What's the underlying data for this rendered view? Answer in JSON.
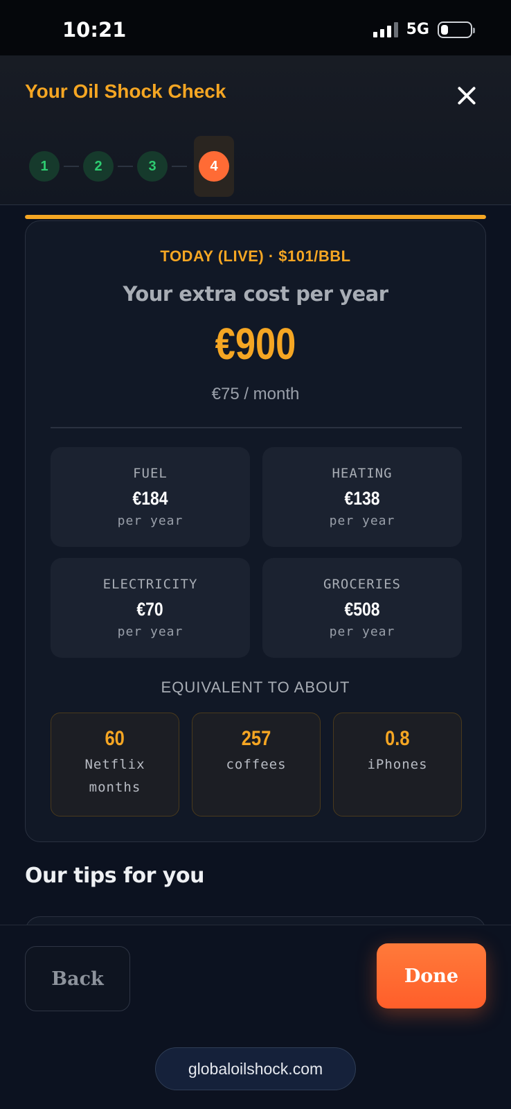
{
  "status_bar": {
    "time": "10:21",
    "network": "5G",
    "battery_level": 0.25
  },
  "header": {
    "title": "Your Oil Shock Check",
    "close_icon": "close-icon",
    "steps": [
      {
        "label": "1",
        "state": "done"
      },
      {
        "label": "2",
        "state": "done"
      },
      {
        "label": "3",
        "state": "done"
      },
      {
        "label": "4",
        "state": "active"
      }
    ]
  },
  "progress": {
    "fraction": 1.0
  },
  "result": {
    "live_label": "TODAY (LIVE) · $101/BBL",
    "heading": "Your extra cost per year",
    "amount": "€900",
    "monthly": "€75 / month",
    "breakdown": [
      {
        "name": "FUEL",
        "value": "€184",
        "unit": "per year"
      },
      {
        "name": "HEATING",
        "value": "€138",
        "unit": "per year"
      },
      {
        "name": "ELECTRICITY",
        "value": "€70",
        "unit": "per year"
      },
      {
        "name": "GROCERIES",
        "value": "€508",
        "unit": "per year"
      }
    ],
    "equivalent_heading": "EQUIVALENT TO ABOUT",
    "equivalents": [
      {
        "value": "60",
        "label": "Netflix months"
      },
      {
        "value": "257",
        "label": "coffees"
      },
      {
        "value": "0.8",
        "label": "iPhones"
      }
    ]
  },
  "tips": {
    "title": "Our tips for you"
  },
  "footer": {
    "back_label": "Back",
    "done_label": "Done",
    "site": "globaloilshock.com"
  },
  "colors": {
    "accent": "#f5a623",
    "primary_button": "#ff6b35",
    "step_done": "#2ecc71",
    "background": "#0c1220"
  }
}
